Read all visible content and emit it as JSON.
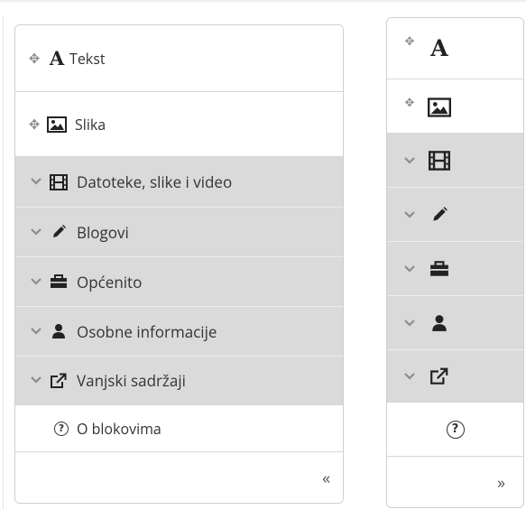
{
  "expanded_panel": {
    "items": [
      {
        "control": "+",
        "icon": "text-icon",
        "icon_glyph": "A",
        "label": "Tekst"
      },
      {
        "control": "+",
        "icon": "image-icon",
        "label": "Slika"
      },
      {
        "control": "v",
        "icon": "film-icon",
        "label": "Datoteke, slike i video"
      },
      {
        "control": "v",
        "icon": "pencil-icon",
        "label": "Blogovi"
      },
      {
        "control": "v",
        "icon": "briefcase-icon",
        "label": "Općenito"
      },
      {
        "control": "v",
        "icon": "user-icon",
        "label": "Osobne informacije"
      },
      {
        "control": "v",
        "icon": "external-link-icon",
        "label": "Vanjski sadržaji"
      },
      {
        "control": "",
        "icon": "help-icon",
        "icon_glyph": "?",
        "label": "O blokovima"
      }
    ],
    "dock_label": "«"
  },
  "collapsed_panel": {
    "icon_glyph_text": "A",
    "icon_glyph_help": "?",
    "dock_label": "»"
  },
  "colors": {
    "grey_row": "#dadada",
    "white_row": "#ffffff",
    "border": "#cfcfcf",
    "icon": "#222222",
    "control": "#8c8c8c"
  }
}
